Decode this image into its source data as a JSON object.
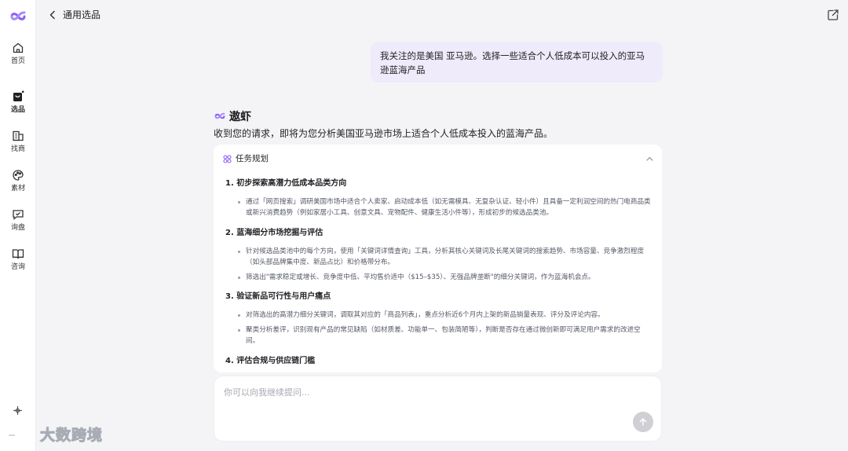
{
  "app": {
    "brand_color": "#8b5cf6"
  },
  "sidebar": {
    "items": [
      {
        "label": "首页",
        "icon": "home-icon"
      },
      {
        "label": "选品",
        "icon": "shopping-bag-icon",
        "active": true
      },
      {
        "label": "找商",
        "icon": "building-icon"
      },
      {
        "label": "素材",
        "icon": "palette-icon"
      },
      {
        "label": "询盘",
        "icon": "inquiry-icon"
      },
      {
        "label": "咨询",
        "icon": "book-icon"
      }
    ],
    "bottom_icon": "plus-icon"
  },
  "header": {
    "title": "通用选品",
    "back_icon": "chevron-left-icon",
    "share_icon": "external-link-icon"
  },
  "conversation": {
    "user_message": "我关注的是美国 亚马逊。选择一些适合个人低成本可以投入的亚马逊蓝海产品",
    "assistant": {
      "name": "遨虾",
      "intro": "收到您的请求，即将为您分析美国亚马逊市场上适合个人低成本投入的蓝海产品。"
    }
  },
  "task_plan": {
    "title": "任务规划",
    "steps": [
      {
        "title": "1. 初步探索高潜力低成本品类方向",
        "bullets": [
          "通过「网页搜索」调研美国市场中适合个人卖家、启动成本低（如无需模具、无复杂认证、轻小件）且具备一定利润空间的热门电商品类或新兴消费趋势（例如家居小工具、创意文具、宠物配件、健康生活小件等），形成初步的候选品类池。"
        ]
      },
      {
        "title": "2. 蓝海细分市场挖掘与评估",
        "bullets": [
          "针对候选品类池中的每个方向，使用「关键词详情查询」工具，分析其核心关键词及长尾关键词的搜索趋势、市场容量、竞争激烈程度（如头部品牌集中度、新品占比）和价格带分布。",
          "筛选出\"需求稳定或增长、竞争度中低、平均售价适中（$15–$35）、无强品牌垄断\"的细分关键词，作为蓝海机会点。"
        ]
      },
      {
        "title": "3. 验证新品可行性与用户痛点",
        "bullets": [
          "对筛选出的高潜力细分关键词，调取其对应的「商品列表」，重点分析近6个月内上架的新品销量表现、评分及评论内容。",
          "聚类分析差评，识别现有产品的常见缺陷（如材质差、功能单一、包装简陋等），判断是否存在通过微创新即可满足用户需求的改进空间。"
        ]
      },
      {
        "title": "4. 评估合规与供应链门槛",
        "bullets": []
      }
    ]
  },
  "input": {
    "placeholder": "你可以向我继续提问..."
  },
  "watermark": {
    "text": "大数跨境"
  }
}
